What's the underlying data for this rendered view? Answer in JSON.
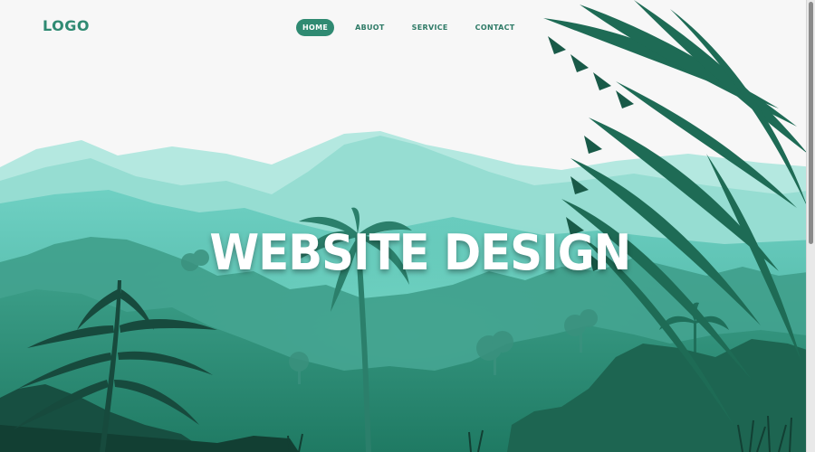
{
  "header": {
    "logo": "LOGO"
  },
  "nav": {
    "items": [
      {
        "label": "HOME",
        "active": true
      },
      {
        "label": "ABUOT",
        "active": false
      },
      {
        "label": "SERVICE",
        "active": false
      },
      {
        "label": "CONTACT",
        "active": false
      }
    ]
  },
  "hero": {
    "title": "WEBSITE DESIGN"
  },
  "colors": {
    "accent": "#2f8a72",
    "background": "#f7f7f7",
    "mountain_light": "#a8e3da",
    "jungle_dark": "#1e6b55"
  },
  "icons": {
    "scene": "jungle-landscape-illustration"
  }
}
